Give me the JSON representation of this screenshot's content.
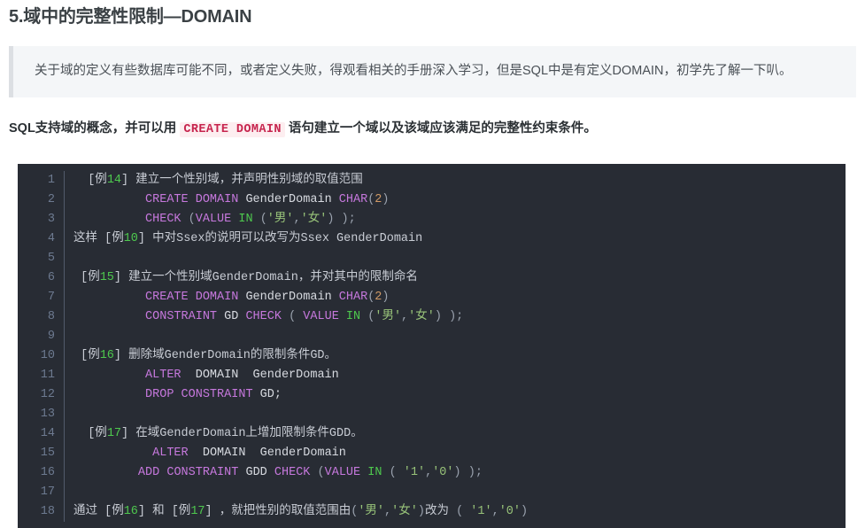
{
  "heading": "5.域中的完整性限制—DOMAIN",
  "blockquote": {
    "text": "关于域的定义有些数据库可能不同，或者定义失败，得观看相关的手册深入学习，但是SQL中是有定义DOMAIN，初学先了解一下叭。"
  },
  "lead_para": {
    "before": "SQL支持域的概念，并可以用 ",
    "code": "CREATE DOMAIN",
    "after": " 语句建立一个域以及该域应该满足的完整性约束条件。"
  },
  "code_block": {
    "language": "sql",
    "line_numbers": [
      "1",
      "2",
      "3",
      "4",
      "5",
      "6",
      "7",
      "8",
      "9",
      "10",
      "11",
      "12",
      "13",
      "14",
      "15",
      "16",
      "17",
      "18"
    ],
    "lines": [
      "  [例14] 建立一个性别域，并声明性别域的取值范围",
      "          CREATE DOMAIN GenderDomain CHAR(2)",
      "          CHECK (VALUE IN ('男','女') );",
      "这样 [例10] 中对Ssex的说明可以改写为Ssex GenderDomain",
      "",
      " [例15] 建立一个性别域GenderDomain，并对其中的限制命名",
      "          CREATE DOMAIN GenderDomain CHAR(2)",
      "          CONSTRAINT GD CHECK ( VALUE IN ('男','女') );",
      "",
      " [例16] 删除域GenderDomain的限制条件GD。",
      "          ALTER  DOMAIN  GenderDomain",
      "          DROP CONSTRAINT GD;",
      "",
      "  [例17] 在域GenderDomain上增加限制条件GDD。",
      "           ALTER  DOMAIN  GenderDomain",
      "         ADD CONSTRAINT GDD CHECK (VALUE IN ( '1','0') );",
      "",
      "通过 [例16] 和 [例17] ，就把性别的取值范围由('男','女')改为 ( '1','0')"
    ]
  },
  "colors": {
    "code_background": "#282c34",
    "keyword": "#c678dd",
    "string": "#98c379",
    "number": "#4ec94e",
    "gutter_text": "#6d7a90",
    "inline_code_text": "#c7254e",
    "inline_code_bg": "#fdeef0",
    "blockquote_bg": "#f4f6f8",
    "blockquote_border": "#dcdfe3",
    "heading_text": "#3b4145"
  }
}
